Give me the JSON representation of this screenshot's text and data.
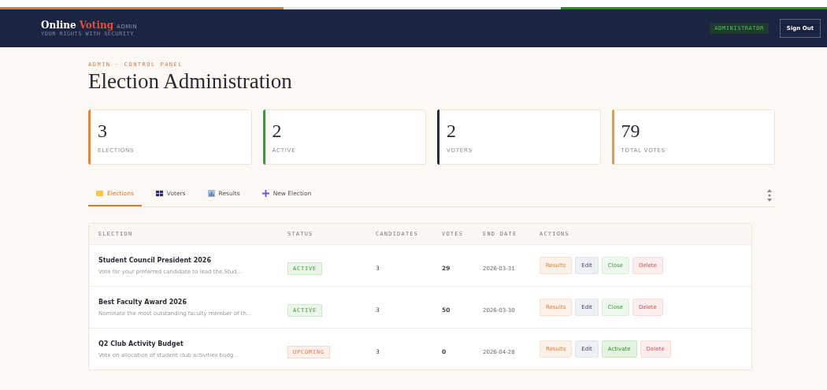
{
  "header": {
    "brand": "Online",
    "brand_accent": "Voting",
    "brand_tag": "ADMIN",
    "tagline": "YOUR RIGHTS WITH SECURITY",
    "role_badge": "ADMINISTRATOR",
    "sign_out": "Sign Out"
  },
  "breadcrumb": "ADMIN · CONTROL PANEL",
  "title": "Election Administration",
  "stats": [
    {
      "value": "3",
      "label": "ELECTIONS",
      "color": "#e8843c"
    },
    {
      "value": "2",
      "label": "ACTIVE",
      "color": "#3a9a3a"
    },
    {
      "value": "2",
      "label": "VOTERS",
      "color": "#1f2a44"
    },
    {
      "value": "79",
      "label": "TOTAL VOTES",
      "color": "#d4a838"
    }
  ],
  "tabs": [
    {
      "label": "Elections",
      "kind": "elections",
      "selected": true
    },
    {
      "label": "Voters",
      "kind": "voters",
      "selected": false
    },
    {
      "label": "Results",
      "kind": "results",
      "selected": false
    },
    {
      "label": "New Election",
      "kind": "new",
      "selected": false
    }
  ],
  "table": {
    "columns": [
      "ELECTION",
      "STATUS",
      "CANDIDATES",
      "VOTES",
      "END DATE",
      "ACTIONS"
    ],
    "rows": [
      {
        "name": "Student Council President 2026",
        "description": "Vote for your preferred candidate to lead the Stud...",
        "status": "ACTIVE",
        "kind": "active",
        "candidates": "3",
        "votes": "29",
        "end_date": "2026-03-31",
        "actions": [
          {
            "label": "Results",
            "kind": "results"
          },
          {
            "label": "Edit",
            "kind": "edit"
          },
          {
            "label": "Close",
            "kind": "close"
          },
          {
            "label": "Delete",
            "kind": "delete"
          }
        ]
      },
      {
        "name": "Best Faculty Award 2026",
        "description": "Nominate the most outstanding faculty member of th...",
        "status": "ACTIVE",
        "kind": "active",
        "candidates": "3",
        "votes": "50",
        "end_date": "2026-03-30",
        "actions": [
          {
            "label": "Results",
            "kind": "results"
          },
          {
            "label": "Edit",
            "kind": "edit"
          },
          {
            "label": "Close",
            "kind": "close"
          },
          {
            "label": "Delete",
            "kind": "delete"
          }
        ]
      },
      {
        "name": "Q2 Club Activity Budget",
        "description": "Vote on allocation of student club activities budg...",
        "status": "UPCOMING",
        "kind": "upcoming",
        "candidates": "3",
        "votes": "0",
        "end_date": "2026-04-28",
        "actions": [
          {
            "label": "Results",
            "kind": "results"
          },
          {
            "label": "Edit",
            "kind": "edit"
          },
          {
            "label": "Activate",
            "kind": "activate"
          },
          {
            "label": "Delete",
            "kind": "delete"
          }
        ]
      }
    ]
  }
}
